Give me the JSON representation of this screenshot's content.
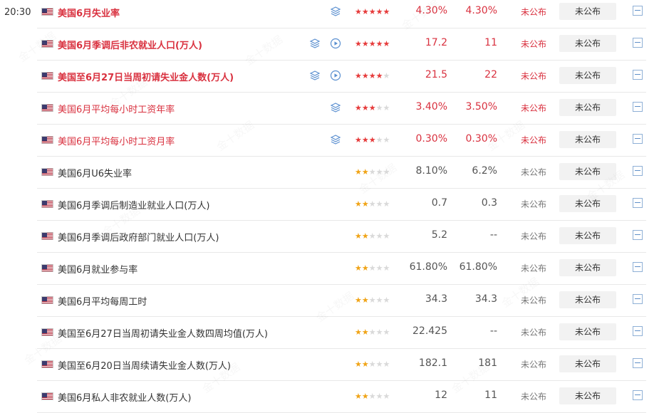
{
  "time": "20:30",
  "status_label": "未公布",
  "button_label": "未公布",
  "watermark": "金十数据",
  "rows": [
    {
      "name": "美国6月失业率",
      "stars": 5,
      "prev": "4.30%",
      "forecast": "4.30%",
      "style": "hi",
      "icons": [
        "layers-icon"
      ]
    },
    {
      "name": "美国6月季调后非农就业人口(万人)",
      "stars": 5,
      "prev": "17.2",
      "forecast": "11",
      "style": "hi",
      "icons": [
        "layers-icon",
        "play-circle-icon"
      ]
    },
    {
      "name": "美国至6月27日当周初请失业金人数(万人)",
      "stars": 4,
      "prev": "21.5",
      "forecast": "22",
      "style": "hi",
      "icons": [
        "layers-icon",
        "play-circle-icon"
      ]
    },
    {
      "name": "美国6月平均每小时工资年率",
      "stars": 3,
      "prev": "3.40%",
      "forecast": "3.50%",
      "style": "mid",
      "icons": [
        "layers-icon"
      ]
    },
    {
      "name": "美国6月平均每小时工资月率",
      "stars": 3,
      "prev": "0.30%",
      "forecast": "0.30%",
      "style": "mid",
      "icons": [
        "layers-icon"
      ]
    },
    {
      "name": "美国6月U6失业率",
      "stars": 2,
      "prev": "8.10%",
      "forecast": "6.2%",
      "style": "low",
      "icons": []
    },
    {
      "name": "美国6月季调后制造业就业人口(万人)",
      "stars": 2,
      "prev": "0.7",
      "forecast": "0.3",
      "style": "low",
      "icons": []
    },
    {
      "name": "美国6月季调后政府部门就业人口(万人)",
      "stars": 2,
      "prev": "5.2",
      "forecast": "--",
      "style": "low",
      "icons": []
    },
    {
      "name": "美国6月就业参与率",
      "stars": 2,
      "prev": "61.80%",
      "forecast": "61.80%",
      "style": "low",
      "icons": []
    },
    {
      "name": "美国6月平均每周工时",
      "stars": 2,
      "prev": "34.3",
      "forecast": "34.3",
      "style": "low",
      "icons": []
    },
    {
      "name": "美国至6月27日当周初请失业金人数四周均值(万人)",
      "stars": 2,
      "prev": "22.425",
      "forecast": "--",
      "style": "low",
      "icons": []
    },
    {
      "name": "美国至6月20日当周续请失业金人数(万人)",
      "stars": 2,
      "prev": "182.1",
      "forecast": "181",
      "style": "low",
      "icons": []
    },
    {
      "name": "美国6月私人非农就业人数(万人)",
      "stars": 2,
      "prev": "12",
      "forecast": "11",
      "style": "low",
      "icons": []
    }
  ]
}
